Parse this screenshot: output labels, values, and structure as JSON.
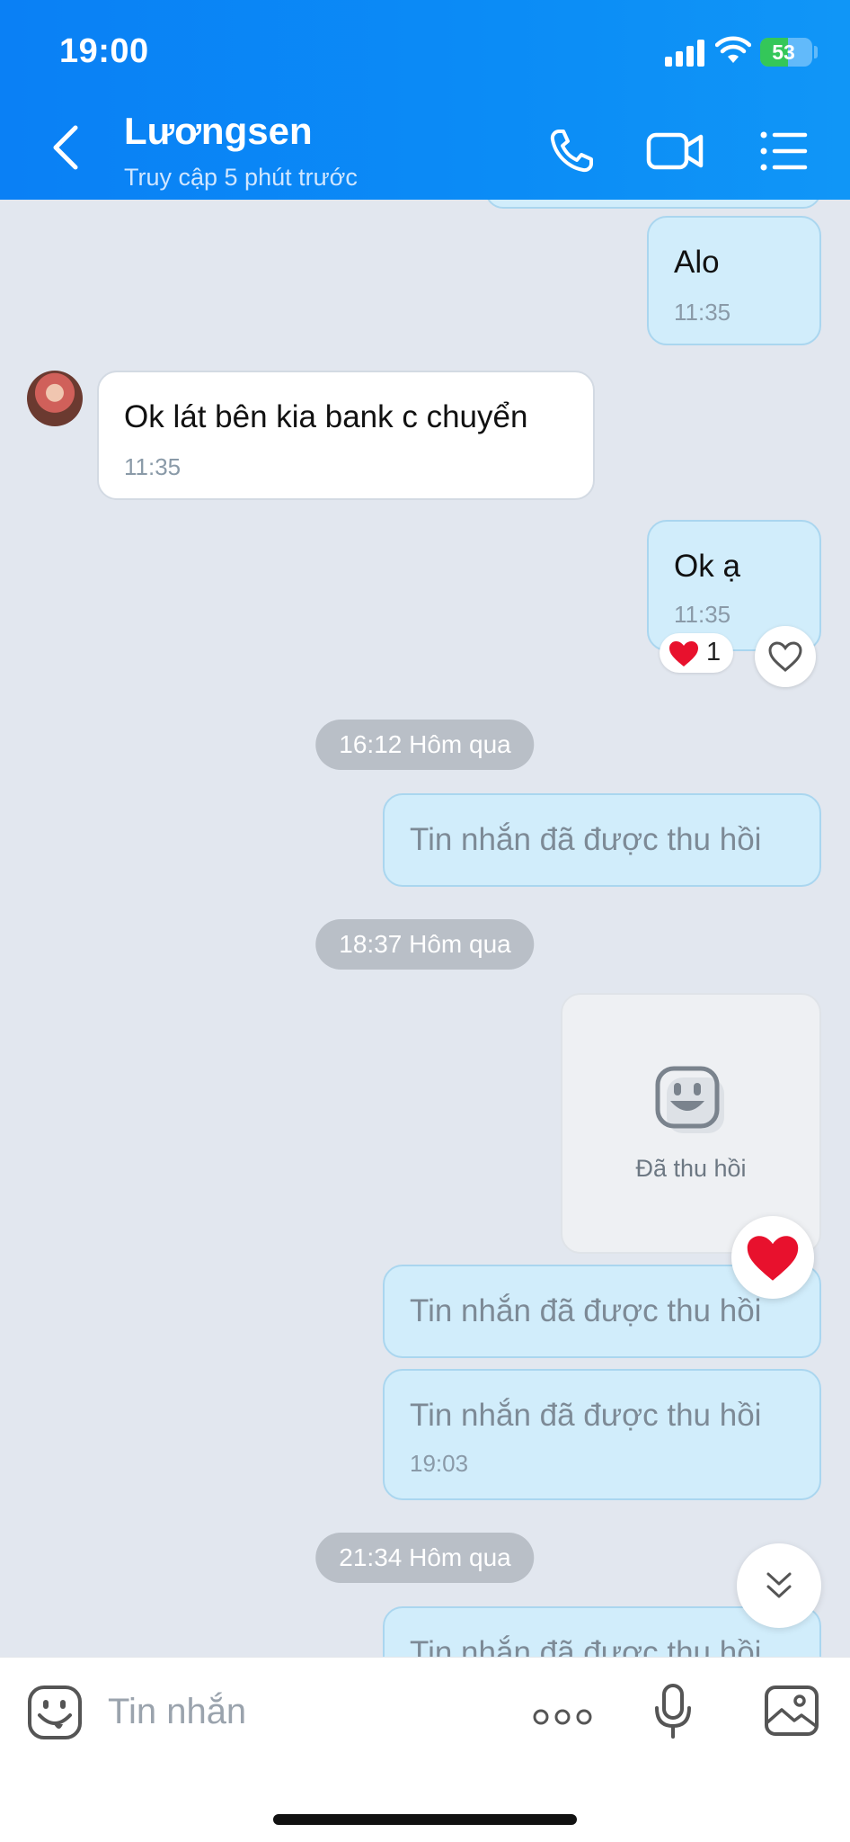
{
  "status_bar": {
    "time": "19:00",
    "battery": "53"
  },
  "header": {
    "title": "Lươngsen",
    "subtitle": "Truy cập 5 phút trước"
  },
  "messages": [
    {
      "text": "Alo",
      "time": "11:35"
    },
    {
      "text": "Ok lát bên kia bank c chuyển",
      "time": "11:35"
    },
    {
      "text": "Ok ạ",
      "time": "11:35",
      "reaction_count": "1"
    },
    {
      "text": "Tin nhắn đã được thu hồi"
    },
    {
      "text": "Đã thu hồi"
    },
    {
      "text": "Tin nhắn đã được thu hồi"
    },
    {
      "text": "Tin nhắn đã được thu hồi",
      "time": "19:03"
    },
    {
      "text": "Tin nhắn đã được thu hồi"
    }
  ],
  "date_separators": [
    "16:12 Hôm qua",
    "18:37 Hôm qua",
    "21:34 Hôm qua"
  ],
  "input": {
    "placeholder": "Tin nhắn"
  },
  "colors": {
    "header": "#0a80f5",
    "outgoing_bubble": "#d1edfb",
    "chat_background": "#e2e7ef",
    "reaction": "#e8112d"
  }
}
